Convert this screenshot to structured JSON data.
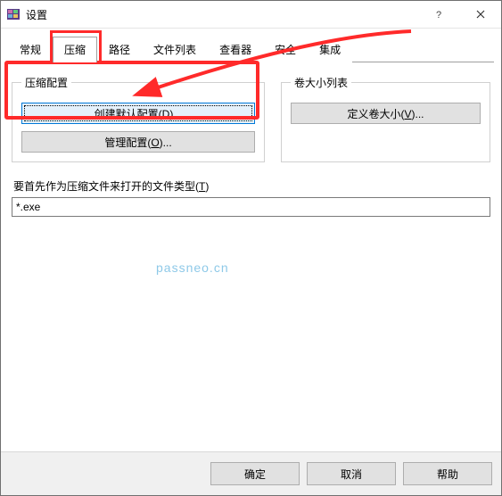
{
  "window": {
    "title": "设置"
  },
  "tabs": {
    "items": [
      {
        "label": "常规"
      },
      {
        "label": "压缩"
      },
      {
        "label": "路径"
      },
      {
        "label": "文件列表"
      },
      {
        "label": "查看器"
      },
      {
        "label": "安全"
      },
      {
        "label": "集成"
      }
    ],
    "active_index": 1
  },
  "groups": {
    "compress": {
      "legend": "压缩配置",
      "create_default_prefix": "创建默认配置(",
      "create_default_key": "D",
      "create_default_suffix": ")...",
      "manage_prefix": "管理配置(",
      "manage_key": "O",
      "manage_suffix": ")..."
    },
    "volume": {
      "legend": "卷大小列表",
      "define_prefix": "定义卷大小(",
      "define_key": "V",
      "define_suffix": ")..."
    }
  },
  "open_types": {
    "label_prefix": "要首先作为压缩文件来打开的文件类型(",
    "label_key": "T",
    "label_suffix": ")",
    "value": "*.exe"
  },
  "watermark": "passneo.cn",
  "footer": {
    "ok": "确定",
    "cancel": "取消",
    "help": "帮助"
  }
}
